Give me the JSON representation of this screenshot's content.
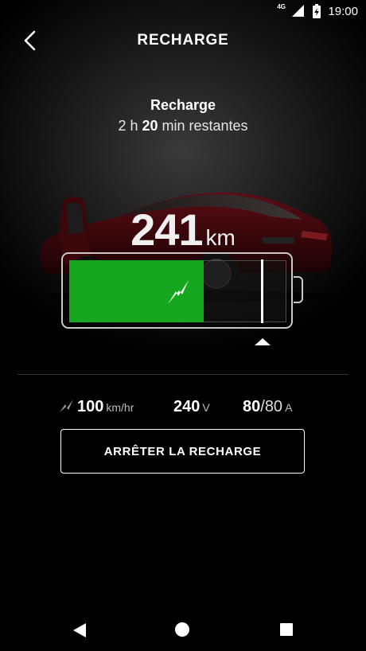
{
  "status_bar": {
    "network": "4G",
    "time": "19:00"
  },
  "header": {
    "title": "RECHARGE"
  },
  "charge": {
    "title": "Recharge",
    "remaining_prefix": "2 h ",
    "remaining_minutes": "20",
    "remaining_suffix": " min restantes"
  },
  "range": {
    "value": "241",
    "unit": "km"
  },
  "battery": {
    "level_percent": 62,
    "limit_percent": 89,
    "fill_color": "#15a71d"
  },
  "stats": {
    "speed_value": "100",
    "speed_unit": "km/hr",
    "voltage_value": "240",
    "voltage_unit": "V",
    "current_actual": "80",
    "current_sep": "/",
    "current_max": "80",
    "current_unit": "A"
  },
  "actions": {
    "stop_label": "ARRÊTER LA RECHARGE"
  },
  "icons": {
    "back": "chevron-left-icon",
    "bolt": "lightning-bolt-icon",
    "speed": "charging-speed-icon"
  }
}
